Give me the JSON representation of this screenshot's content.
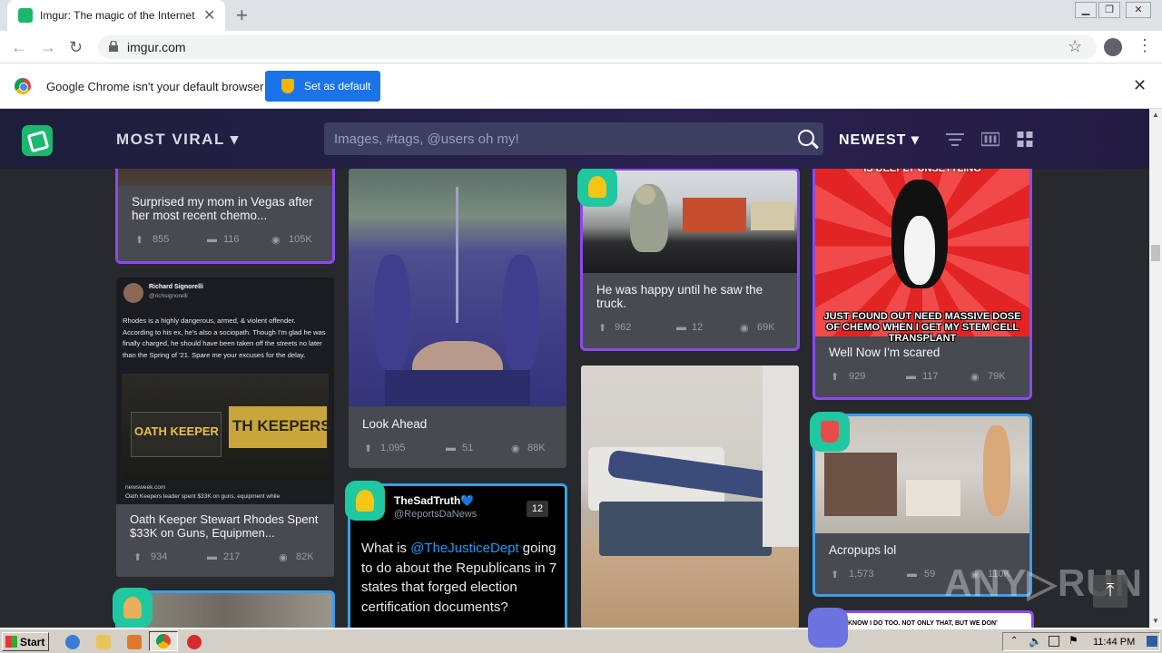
{
  "browser": {
    "tab_title": "Imgur: The magic of the Internet",
    "url": "imgur.com",
    "infobar_message": "Google Chrome isn't your default browser",
    "set_default_label": "Set as default"
  },
  "imgur": {
    "section": "MOST VIRAL ▾",
    "search_placeholder": "Images, #tags, @users oh my!",
    "sort": "NEWEST ▾"
  },
  "posts": [
    {
      "title": "Surprised my mom in Vegas after her most recent chemo...",
      "ups": "855",
      "comments": "116",
      "views": "105K"
    },
    {
      "title": "Oath Keeper Stewart Rhodes Spent $33K on Guns, Equipmen...",
      "ups": "934",
      "comments": "217",
      "views": "82K",
      "tweet_name": "Richard Signorelli",
      "tweet_handle": "@richsignorelli",
      "tweet_text": "Rhodes is a highly dangerous, armed, & violent offender. According to his ex, he's also a sociopath. Though I'm glad he was finally charged, he should have been taken off the streets no later than the Spring of '21. Spare me your excuses for the delay.",
      "shirt_text": "OATH KEEPER",
      "banner_text": "TH KEEPERS",
      "source": "newsweek.com",
      "caption": "Oath Keepers leader spent $33K on guns, equipment while"
    },
    {
      "title": "Look Ahead",
      "ups": "1,095",
      "comments": "51",
      "views": "88K"
    },
    {
      "tweet_name": "TheSadTruth💙",
      "tweet_handle": "@ReportsDaNews",
      "count": "12",
      "tweet_mention": "@TheJusticeDept",
      "tweet_before": "What is ",
      "tweet_after": " going to do about the Republicans in 7 states that forged election certification documents?"
    },
    {
      "title": "He was happy until he saw the truck.",
      "ups": "962",
      "comments": "12",
      "views": "69K"
    },
    {
      "title": "Well Now I'm scared",
      "ups": "929",
      "comments": "117",
      "views": "79K",
      "meme_top": "IS DEEPLY UNSETTLING",
      "meme_text": "JUST FOUND OUT NEED MASSIVE DOSE OF CHEMO WHEN I GET MY STEM CELL TRANSPLANT"
    },
    {
      "title": "Acropups lol",
      "ups": "1,573",
      "comments": "59",
      "views": "110K"
    },
    {
      "comic_text": "KNOW  I DO TOO.  NOT ONLY THAT, BUT WE DON'"
    }
  ],
  "overlay": {
    "watermark": "ANY▷RUN",
    "to_top": "⤒"
  },
  "taskbar": {
    "start": "Start",
    "clock": "11:44 PM"
  },
  "colors": {
    "imgur_green": "#1bb76e",
    "promoted_purple": "#8a4af0",
    "blue_outline": "#3a9ee8",
    "header_bg": "#1c1e3a"
  }
}
